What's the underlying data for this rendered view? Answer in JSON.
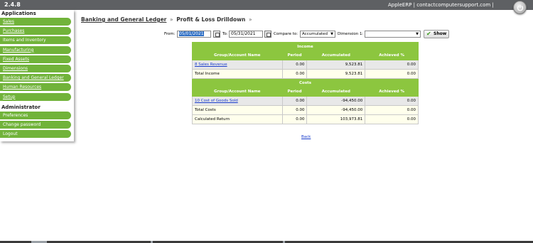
{
  "app": {
    "version": "2.4.8",
    "brand_line": "AppleERP | contactcomputersupport.com |"
  },
  "sidebar": {
    "applications_title": "Applications",
    "applications": [
      {
        "label": "Sales"
      },
      {
        "label": "Purchases"
      },
      {
        "label": "Items and Inventory"
      },
      {
        "label": "Manufacturing"
      },
      {
        "label": "Fixed Assets"
      },
      {
        "label": "Dimensions"
      },
      {
        "label": "Banking and General Ledger"
      },
      {
        "label": "Human Resources"
      },
      {
        "label": "Setup"
      }
    ],
    "administrator_title": "Administrator",
    "administrator": [
      {
        "label": "Preferences"
      },
      {
        "label": "Change password"
      },
      {
        "label": "Logout"
      }
    ]
  },
  "breadcrumb": {
    "parent": "Banking and General Ledger",
    "sep1": "»",
    "current": "Profit & Loss Drilldown",
    "sep2": "»"
  },
  "filters": {
    "from_label": "From:",
    "from_value": "05/01/2021",
    "to_label": "To:",
    "to_value": "05/31/2021",
    "compare_label": "Compare to:",
    "compare_value": "Accumulated",
    "dimension_label": "Dimension 1:",
    "dimension_value": "",
    "show_label": "Show"
  },
  "report": {
    "income_title": "Income",
    "costs_title": "Costs",
    "columns": [
      "Group/Account Name",
      "Period",
      "Accumulated",
      "Achieved %"
    ],
    "income_rows": [
      {
        "name": "8 Sales Revenue",
        "period": "0.00",
        "accumulated": "9,523.81",
        "achieved": "0.00"
      }
    ],
    "total_income": {
      "name": "Total Income",
      "period": "0.00",
      "accumulated": "9,523.81",
      "achieved": "0.00"
    },
    "cost_rows": [
      {
        "name": "10 Cost of Goods Sold",
        "period": "0.00",
        "accumulated": "-94,450.00",
        "achieved": "0.00"
      }
    ],
    "total_costs": {
      "name": "Total Costs",
      "period": "0.00",
      "accumulated": "-94,450.00",
      "achieved": "0.00"
    },
    "calculated_return": {
      "name": "Calculated Return",
      "period": "0.00",
      "accumulated": "103,973.81",
      "achieved": "0.00"
    }
  },
  "back_label": "Back",
  "colors": {
    "header_bg": "#5e6063",
    "menu_green": "#71b33a",
    "table_green": "#8cc63f",
    "link_blue": "#1a3dcc"
  },
  "icons": {
    "logout": "power-icon",
    "calendar": "calendar-icon",
    "show": "check-icon"
  }
}
